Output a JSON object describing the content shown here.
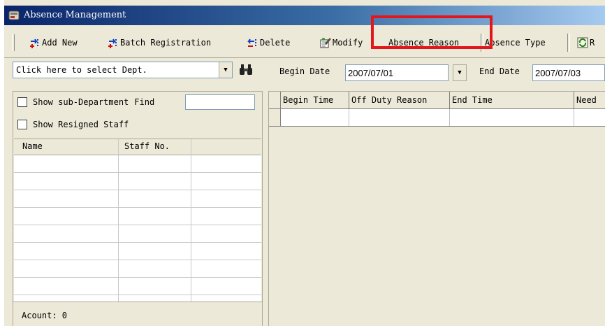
{
  "window": {
    "title": "Absence Management"
  },
  "toolbar": {
    "add_new": "Add New",
    "batch_registration": "Batch Registration",
    "delete": "Delete",
    "modify": "Modify",
    "absence_reason": "Absence Reason",
    "absence_type": "Absence Type",
    "trailing_label": "R"
  },
  "left": {
    "dept_placeholder": "Click here to select Dept.",
    "show_sub_department": "Show sub-Department",
    "find_label": "Find",
    "show_resigned": "Show Resigned Staff",
    "columns": [
      "Name",
      "Staff No."
    ],
    "status": "Acount: 0"
  },
  "filters": {
    "begin_label": "Begin Date",
    "begin_value": "2007/07/01",
    "end_label": "End Date",
    "end_value": "2007/07/03"
  },
  "grid": {
    "columns": [
      "Begin Time",
      "Off Duty Reason",
      "End Time",
      "Need"
    ]
  },
  "colors": {
    "highlight": "#e4161b",
    "title_bar": "#0a246a"
  }
}
